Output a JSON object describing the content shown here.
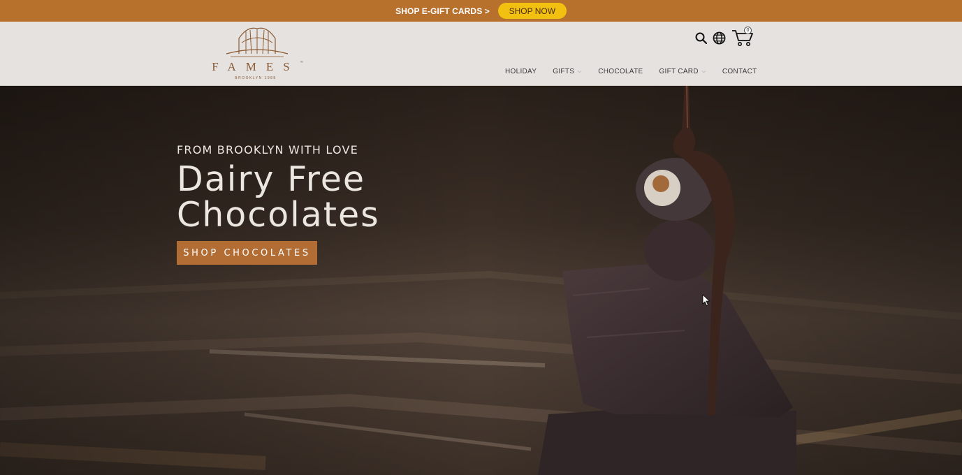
{
  "promo": {
    "text": "SHOP E-GIFT CARDS >",
    "button_label": "SHOP NOW"
  },
  "header": {
    "logo": {
      "word": "FAMES",
      "tm": "™",
      "subtitle": "BROOKLYN 1988"
    },
    "icons": {
      "search": "search-icon",
      "globe": "globe-icon",
      "cart": "cart-icon",
      "cart_count": "0"
    },
    "nav": [
      {
        "label": "HOLIDAY",
        "has_dropdown": false
      },
      {
        "label": "GIFTS",
        "has_dropdown": true
      },
      {
        "label": "CHOCOLATE",
        "has_dropdown": false
      },
      {
        "label": "GIFT CARD",
        "has_dropdown": true
      },
      {
        "label": "CONTACT",
        "has_dropdown": false
      }
    ]
  },
  "hero": {
    "eyebrow": "FROM BROOKLYN WITH LOVE",
    "title_line1": "Dairy Free",
    "title_line2": "Chocolates",
    "button_label": "SHOP CHOCOLATES"
  },
  "colors": {
    "promo_bg": "#b8702d",
    "promo_button": "#f2c011",
    "header_bg": "#e6e2df",
    "brand_brown": "#8a5a34",
    "hero_button": "#b26d34"
  }
}
